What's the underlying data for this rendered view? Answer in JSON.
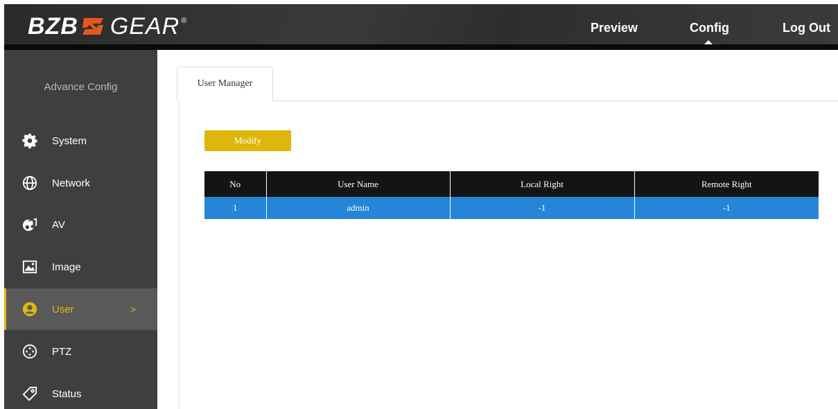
{
  "header": {
    "logo": {
      "left_text": "BZB",
      "right_text": "GEAR",
      "reg_mark": "®"
    },
    "nav": [
      {
        "label": "Preview",
        "active": false
      },
      {
        "label": "Config",
        "active": true
      },
      {
        "label": "Log Out",
        "active": false
      }
    ]
  },
  "sidebar": {
    "title": "Advance Config",
    "items": [
      {
        "label": "System",
        "icon": "gear-icon",
        "active": false
      },
      {
        "label": "Network",
        "icon": "globe-icon",
        "active": false
      },
      {
        "label": "AV",
        "icon": "music-note-icon",
        "active": false
      },
      {
        "label": "Image",
        "icon": "image-icon",
        "active": false
      },
      {
        "label": "User",
        "icon": "user-icon",
        "active": true,
        "chevron": ">"
      },
      {
        "label": "PTZ",
        "icon": "ptz-icon",
        "active": false
      },
      {
        "label": "Status",
        "icon": "tag-icon",
        "active": false
      }
    ]
  },
  "main": {
    "tabs": [
      {
        "label": "User Manager",
        "active": true
      }
    ],
    "modify_label": "Modify",
    "table": {
      "columns": [
        "No",
        "User Name",
        "Local Right",
        "Remote Right"
      ],
      "rows": [
        {
          "no": "1",
          "user_name": "admin",
          "local_right": "-1",
          "remote_right": "-1",
          "selected": true
        }
      ]
    }
  },
  "colors": {
    "accent": "#ddb70b",
    "selected_row": "#2585d9",
    "header_bg": "#333333",
    "sidebar_bg": "#3f3f3f",
    "table_header_bg": "#141414"
  }
}
